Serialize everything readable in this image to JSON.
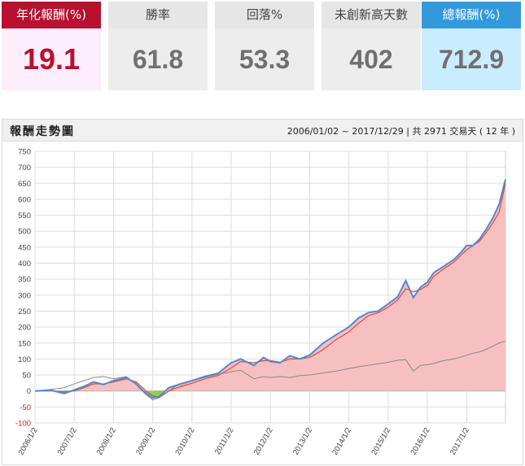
{
  "cards": [
    {
      "label": "年化報酬(%)",
      "value": "19.1"
    },
    {
      "label": "勝率",
      "value": "61.8"
    },
    {
      "label": "回落%",
      "value": "53.3"
    },
    {
      "label": "未創新高天數",
      "value": "402"
    },
    {
      "label": "總報酬(%)",
      "value": "712.9"
    }
  ],
  "panel": {
    "title": "報酬走勢圖",
    "range": "2006/01/02 ~ 2017/12/29 | 共 2971 交易天 ( 12 年 )"
  },
  "colors": {
    "strategy": "#4d8ad2",
    "ma": "#e8453c",
    "benchmark": "#888888",
    "pos_fill": "#f7c0c0",
    "neg_fill": "#99cc55"
  },
  "chart_data": {
    "type": "area",
    "ylim": [
      -100,
      750
    ],
    "yticks": [
      -100,
      -50,
      0,
      50,
      100,
      150,
      200,
      250,
      300,
      350,
      400,
      450,
      500,
      550,
      600,
      650,
      700,
      750
    ],
    "xlim": [
      "2006/1/2",
      "2017/12/29"
    ],
    "xticks": [
      "2006/1/2",
      "2007/1/2",
      "2008/1/2",
      "2009/1/2",
      "2010/1/2",
      "2011/1/2",
      "2012/1/2",
      "2013/1/2",
      "2014/1/2",
      "2015/1/2",
      "2016/1/2",
      "2017/1/2"
    ],
    "series": [
      {
        "x": [
          "2006/1/2",
          "2006/6/1",
          "2006/10/1",
          "2007/1/2",
          "2007/4/1",
          "2007/7/1",
          "2007/10/1",
          "2008/1/2",
          "2008/5/1",
          "2008/8/1",
          "2008/11/1",
          "2009/1/2",
          "2009/3/1",
          "2009/6/1",
          "2009/9/1",
          "2010/1/2",
          "2010/5/1",
          "2010/9/1",
          "2011/1/2",
          "2011/4/1",
          "2011/8/1",
          "2011/11/1",
          "2012/1/2",
          "2012/4/1",
          "2012/7/1",
          "2012/10/1",
          "2013/1/2",
          "2013/5/1",
          "2013/9/1",
          "2014/1/2",
          "2014/4/1",
          "2014/7/1",
          "2014/10/1",
          "2015/1/2",
          "2015/4/1",
          "2015/6/15",
          "2015/8/24",
          "2015/11/1",
          "2016/1/2",
          "2016/3/1",
          "2016/6/1",
          "2016/9/1",
          "2016/11/1",
          "2017/1/2",
          "2017/3/1",
          "2017/5/1",
          "2017/7/1",
          "2017/9/1",
          "2017/11/1",
          "2017/12/29"
        ],
        "values": [
          0,
          2,
          -8,
          3,
          14,
          28,
          20,
          32,
          42,
          22,
          -8,
          -22,
          -18,
          10,
          20,
          32,
          45,
          55,
          88,
          100,
          80,
          105,
          92,
          88,
          110,
          100,
          112,
          148,
          175,
          200,
          228,
          245,
          250,
          272,
          295,
          345,
          292,
          325,
          340,
          370,
          390,
          410,
          430,
          455,
          455,
          475,
          505,
          540,
          585,
          662
        ]
      },
      {
        "x": [
          "2006/1/2",
          "2006/6/1",
          "2006/10/1",
          "2007/1/2",
          "2007/4/1",
          "2007/7/1",
          "2007/10/1",
          "2008/1/2",
          "2008/5/1",
          "2008/8/1",
          "2008/11/1",
          "2009/1/2",
          "2009/3/1",
          "2009/6/1",
          "2009/9/1",
          "2010/1/2",
          "2010/5/1",
          "2010/9/1",
          "2011/1/2",
          "2011/4/1",
          "2011/8/1",
          "2011/11/1",
          "2012/1/2",
          "2012/4/1",
          "2012/7/1",
          "2012/10/1",
          "2013/1/2",
          "2013/5/1",
          "2013/9/1",
          "2014/1/2",
          "2014/4/1",
          "2014/7/1",
          "2014/10/1",
          "2015/1/2",
          "2015/4/1",
          "2015/6/15",
          "2015/8/24",
          "2015/11/1",
          "2016/1/2",
          "2016/3/1",
          "2016/6/1",
          "2016/9/1",
          "2016/11/1",
          "2017/1/2",
          "2017/3/1",
          "2017/5/1",
          "2017/7/1",
          "2017/9/1",
          "2017/11/1",
          "2017/12/29"
        ],
        "values": [
          0,
          0,
          -3,
          0,
          10,
          22,
          22,
          28,
          38,
          28,
          0,
          -15,
          -20,
          0,
          12,
          24,
          38,
          48,
          72,
          92,
          88,
          95,
          95,
          90,
          100,
          100,
          105,
          128,
          160,
          185,
          212,
          235,
          245,
          262,
          285,
          320,
          310,
          318,
          330,
          358,
          382,
          402,
          422,
          442,
          455,
          468,
          495,
          525,
          560,
          650
        ]
      },
      {
        "x": [
          "2006/1/2",
          "2006/6/1",
          "2006/10/1",
          "2007/1/2",
          "2007/4/1",
          "2007/7/1",
          "2007/10/1",
          "2008/1/2",
          "2008/5/1",
          "2008/8/1",
          "2008/11/1",
          "2009/1/2",
          "2009/3/1",
          "2009/6/1",
          "2009/9/1",
          "2010/1/2",
          "2010/5/1",
          "2010/9/1",
          "2011/1/2",
          "2011/4/1",
          "2011/8/1",
          "2011/11/1",
          "2012/1/2",
          "2012/4/1",
          "2012/7/1",
          "2012/10/1",
          "2013/1/2",
          "2013/5/1",
          "2013/9/1",
          "2014/1/2",
          "2014/4/1",
          "2014/7/1",
          "2014/10/1",
          "2015/1/2",
          "2015/4/1",
          "2015/6/15",
          "2015/8/24",
          "2015/11/1",
          "2016/1/2",
          "2016/3/1",
          "2016/6/1",
          "2016/9/1",
          "2016/11/1",
          "2017/1/2",
          "2017/3/1",
          "2017/5/1",
          "2017/7/1",
          "2017/9/1",
          "2017/11/1",
          "2017/12/29"
        ],
        "values": [
          0,
          5,
          10,
          22,
          32,
          42,
          45,
          38,
          45,
          20,
          -12,
          -28,
          -22,
          0,
          22,
          32,
          42,
          52,
          60,
          65,
          38,
          45,
          42,
          45,
          42,
          48,
          50,
          56,
          62,
          70,
          76,
          80,
          85,
          90,
          96,
          98,
          62,
          80,
          82,
          86,
          95,
          100,
          105,
          112,
          118,
          122,
          130,
          140,
          150,
          156
        ]
      }
    ]
  }
}
